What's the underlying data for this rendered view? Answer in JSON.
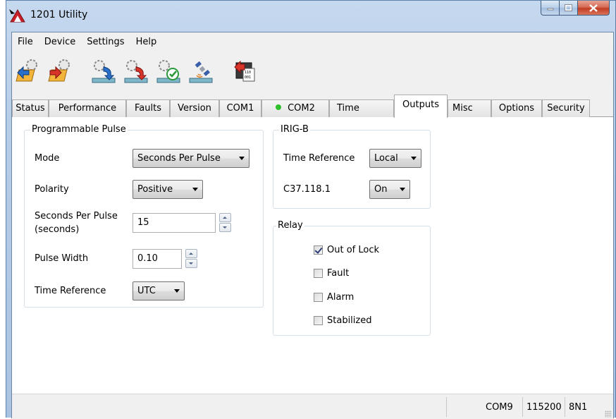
{
  "window": {
    "title": "1201 Utility"
  },
  "menu": [
    "File",
    "Device",
    "Settings",
    "Help"
  ],
  "toolbar": {
    "buttons": [
      {
        "icon": "gear-folder-upload-icon"
      },
      {
        "icon": "gear-folder-download-icon"
      },
      {
        "icon": "gear-upload-icon"
      },
      {
        "icon": "gear-download-icon"
      },
      {
        "icon": "gear-verify-icon"
      },
      {
        "icon": "satellite-icon"
      },
      {
        "icon": "firmware-chip-icon"
      }
    ]
  },
  "tabs": [
    {
      "label": "Status"
    },
    {
      "label": "Performance"
    },
    {
      "label": "Faults"
    },
    {
      "label": "Version"
    },
    {
      "label": "COM1"
    },
    {
      "label": "COM2",
      "indicator_color": "#2ec12e"
    },
    {
      "label": "Time"
    },
    {
      "label": "Outputs",
      "active": true
    },
    {
      "label": "Misc"
    },
    {
      "label": "Options"
    },
    {
      "label": "Security"
    }
  ],
  "programmable_pulse": {
    "title": "Programmable Pulse",
    "mode_label": "Mode",
    "mode_value": "Seconds Per Pulse",
    "polarity_label": "Polarity",
    "polarity_value": "Positive",
    "spp_label_line1": "Seconds Per Pulse",
    "spp_label_line2": "(seconds)",
    "spp_value": "15",
    "pulse_width_label": "Pulse Width",
    "pulse_width_value": "0.10",
    "time_ref_label": "Time Reference",
    "time_ref_value": "UTC"
  },
  "irig_b": {
    "title": "IRIG-B",
    "time_ref_label": "Time Reference",
    "time_ref_value": "Local",
    "c37_label": "C37.118.1",
    "c37_value": "On"
  },
  "relay": {
    "title": "Relay",
    "items": [
      {
        "label": "Out of Lock",
        "checked": true
      },
      {
        "label": "Fault",
        "checked": false
      },
      {
        "label": "Alarm",
        "checked": false
      },
      {
        "label": "Stabilized",
        "checked": false
      }
    ]
  },
  "statusbar": {
    "port": "COM9",
    "baud": "115200",
    "format": "8N1"
  }
}
